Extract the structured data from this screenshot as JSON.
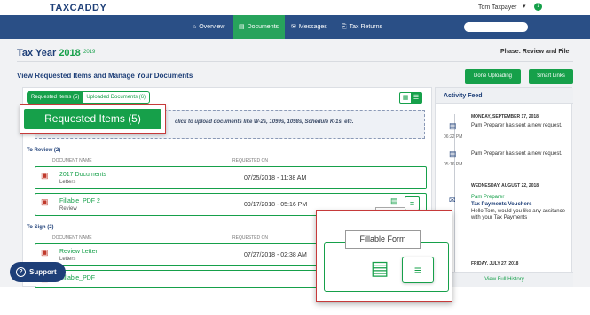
{
  "header": {
    "logo_text": "TAXCADDY",
    "user_name": "Tom Taxpayer",
    "help_glyph": "?"
  },
  "nav": {
    "items": [
      {
        "label": "Overview",
        "icon": "home-icon",
        "active": false
      },
      {
        "label": "Documents",
        "icon": "document-icon",
        "active": true
      },
      {
        "label": "Messages",
        "icon": "message-icon",
        "active": false
      },
      {
        "label": "Tax Returns",
        "icon": "tax-return-icon",
        "active": false
      }
    ],
    "search_value": ""
  },
  "page": {
    "title_prefix": "Tax Year",
    "title_year": "2018",
    "alt_year": "2019",
    "phase": "Phase: Review and File",
    "subtitle": "View Requested Items and Manage Your Documents",
    "done_button": "Done Uploading",
    "smart_links_button": "Smart Links"
  },
  "tabs": {
    "requested": "Requested Items (5)",
    "uploaded": "Uploaded Documents (6)"
  },
  "dropzone": {
    "text": "click to upload documents like W-2s, 1099s, 1098s, Schedule K-1s, etc."
  },
  "to_review": {
    "label": "To Review (2)",
    "col_name": "DOCUMENT NAME",
    "col_requested": "REQUESTED ON",
    "rows": [
      {
        "name": "2017 Documents",
        "category": "Letters",
        "requested_on": "07/25/2018 - 11:38 AM"
      },
      {
        "name": "Fillable_PDF 2",
        "category": "Review",
        "requested_on": "09/17/2018 - 05:16 PM"
      }
    ]
  },
  "to_sign": {
    "label": "To Sign (2)",
    "col_name": "DOCUMENT NAME",
    "col_requested": "REQUESTED ON",
    "rows": [
      {
        "name": "Review Letter",
        "category": "Letters",
        "requested_on": "07/27/2018 - 02:38 AM"
      },
      {
        "name": "Fillable_PDF",
        "category": "",
        "requested_on": ""
      }
    ]
  },
  "feed": {
    "title": "Activity Feed",
    "entries": [
      {
        "date": "MONDAY, SEPTEMBER 17, 2018",
        "time": "06:22 PM",
        "text": "Pam Preparer has sent a new request."
      },
      {
        "date": "",
        "time": "05:16 PM",
        "text": "Pam Preparer has sent a new request."
      },
      {
        "date": "WEDNESDAY, AUGUST 22, 2018",
        "time": "",
        "name": "Pam Preparer",
        "subject": "Tax Payments Vouchers",
        "text": "Hello Tom, would you like any assitance with your Tax Payments"
      },
      {
        "date": "FRIDAY, JULY 27, 2018",
        "time": "",
        "text": ""
      }
    ],
    "footer_link": "View Full History"
  },
  "tooltip": {
    "label": "Fillable Form"
  },
  "callout": {
    "requested_label": "Requested Items (5)"
  },
  "support": {
    "label": "Support"
  },
  "colors": {
    "brand_navy": "#1e3f78",
    "brand_green": "#16a04a",
    "nav_bg": "#2a4f86",
    "callout_border": "#c63a3a"
  }
}
